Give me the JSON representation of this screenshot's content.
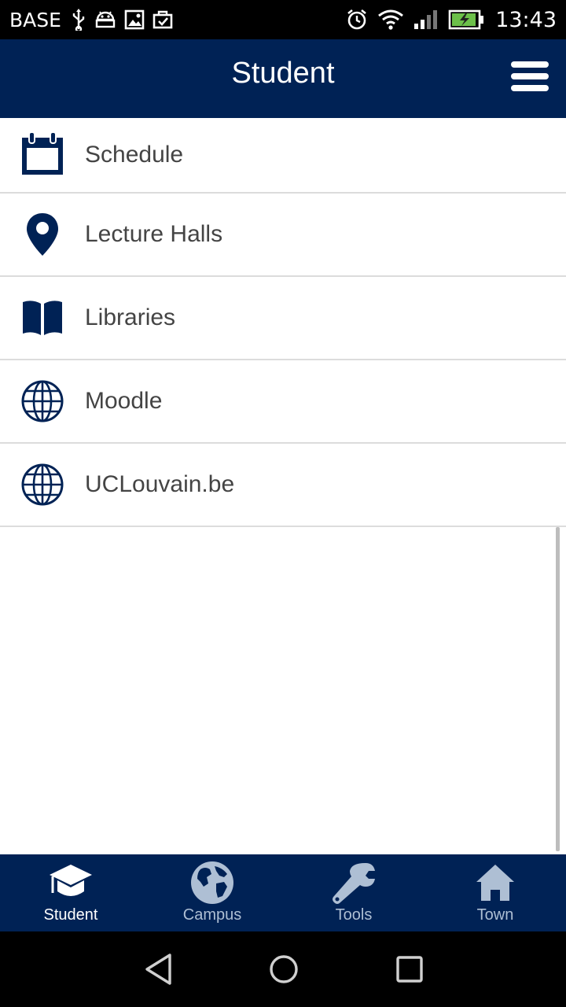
{
  "status_bar": {
    "carrier": "BASE",
    "time": "13:43",
    "left_icons": [
      "usb-icon",
      "android-debug-icon",
      "image-icon",
      "briefcase-check-icon"
    ],
    "right_icons": [
      "alarm-icon",
      "wifi-icon",
      "signal-icon",
      "battery-charging-icon"
    ]
  },
  "app_bar": {
    "title": "Student",
    "menu_icon": "hamburger-menu-icon"
  },
  "menu": {
    "items": [
      {
        "label": "Schedule",
        "icon": "calendar-icon"
      },
      {
        "label": "Lecture Halls",
        "icon": "map-pin-icon"
      },
      {
        "label": "Libraries",
        "icon": "book-icon"
      },
      {
        "label": "Moodle",
        "icon": "globe-icon"
      },
      {
        "label": "UCLouvain.be",
        "icon": "globe-icon"
      }
    ]
  },
  "tab_bar": {
    "tabs": [
      {
        "label": "Student",
        "icon": "graduation-cap-icon",
        "active": true
      },
      {
        "label": "Campus",
        "icon": "earth-icon",
        "active": false
      },
      {
        "label": "Tools",
        "icon": "wrench-icon",
        "active": false
      },
      {
        "label": "Town",
        "icon": "home-icon",
        "active": false
      }
    ]
  },
  "nav_bar": {
    "buttons": [
      "back-icon",
      "home-circle-icon",
      "recents-icon"
    ]
  },
  "colors": {
    "brand": "#002255",
    "text": "#444444",
    "divider": "#dcdcdc",
    "tab_inactive": "#aebfd4",
    "icon": "#002255"
  }
}
